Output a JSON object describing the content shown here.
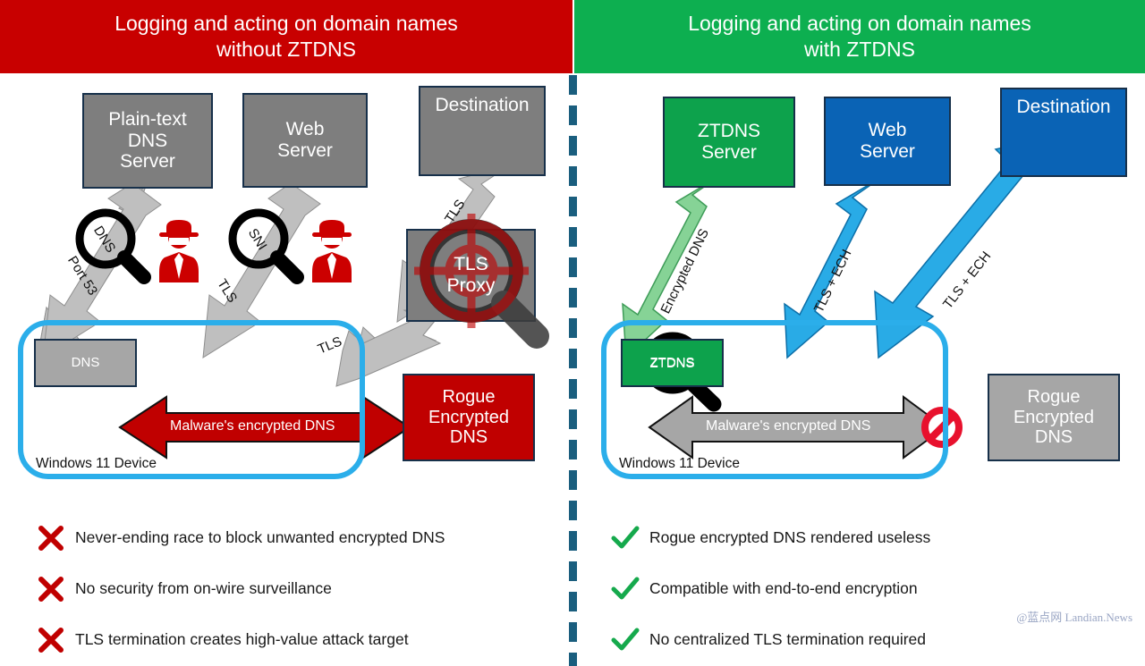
{
  "headers": {
    "left": "Logging and acting on domain names\nwithout ZTDNS",
    "left_line1": "Logging and acting on domain names",
    "left_line2": "without ZTDNS",
    "right_line1": "Logging and acting on domain names",
    "right_line2": "with ZTDNS"
  },
  "colors": {
    "header_red": "#C80000",
    "header_green": "#0DAF50",
    "divider": "#1A5E7E",
    "box_gray": "#7E7E7E",
    "box_gray_light": "#A6A6A6",
    "box_red": "#C00000",
    "box_green": "#0DA24C",
    "box_blue": "#0A63B5",
    "device_outline": "#2BAEEA",
    "arrow_gray": "#BFBFBF",
    "arrow_red": "#C00000",
    "arrow_blue": "#29ABE6",
    "arrow_green_light": "#86D396",
    "check_green": "#15A94C",
    "cross_red": "#C00000",
    "spy_red": "#CC0000",
    "watermark": "#9AA6C4"
  },
  "left_panel": {
    "nodes": [
      {
        "id": "plain-text-dns-server",
        "label": "Plain-text\nDNS\nServer",
        "line1": "Plain-text",
        "line2": "DNS",
        "line3": "Server",
        "color": "gray"
      },
      {
        "id": "web-server",
        "label": "Web\nServer",
        "line1": "Web",
        "line2": "Server",
        "color": "gray"
      },
      {
        "id": "destination",
        "label": "Destination",
        "color": "gray"
      },
      {
        "id": "tls-proxy",
        "label": "TLS\nProxy",
        "line1": "TLS",
        "line2": "Proxy",
        "color": "gray"
      },
      {
        "id": "dns-client",
        "label": "DNS",
        "color": "gray-light"
      },
      {
        "id": "rogue-encrypted-dns",
        "label": "Rogue\nEncrypted\nDNS",
        "line1": "Rogue",
        "line2": "Encrypted",
        "line3": "DNS",
        "color": "red"
      }
    ],
    "arrow_labels": {
      "port53": "Port 53",
      "tls_web": "TLS",
      "tls_proxy": "TLS",
      "tls_destination": "TLS",
      "malware": "Malware's encrypted DNS"
    },
    "magnifier_labels": {
      "dns": "DNS",
      "sni": "SNI"
    },
    "device_label": "Windows 11 Device",
    "spy_icons": 2
  },
  "right_panel": {
    "nodes": [
      {
        "id": "ztdns-server",
        "label": "ZTDNS\nServer",
        "line1": "ZTDNS",
        "line2": "Server",
        "color": "green"
      },
      {
        "id": "web-server",
        "label": "Web\nServer",
        "line1": "Web",
        "line2": "Server",
        "color": "blue"
      },
      {
        "id": "destination",
        "label": "Destination",
        "color": "blue"
      },
      {
        "id": "ztdns-client",
        "label": "ZTDNS",
        "color": "green"
      },
      {
        "id": "rogue-encrypted-dns",
        "label": "Rogue\nEncrypted\nDNS",
        "line1": "Rogue",
        "line2": "Encrypted",
        "line3": "DNS",
        "color": "gray-light"
      }
    ],
    "arrow_labels": {
      "encrypted_dns": "Encrypted DNS",
      "tls_ech_web": "TLS + ECH",
      "tls_ech_destination": "TLS + ECH",
      "malware": "Malware's encrypted DNS"
    },
    "device_label": "Windows 11 Device",
    "blocked_icon": "no-entry-icon"
  },
  "left_bullets": [
    {
      "marker": "cross-icon",
      "text": "Never-ending race to block unwanted encrypted DNS"
    },
    {
      "marker": "cross-icon",
      "text": "No security from on-wire surveillance"
    },
    {
      "marker": "cross-icon",
      "text": "TLS termination creates high-value attack target"
    }
  ],
  "right_bullets": [
    {
      "marker": "check-icon",
      "text": "Rogue encrypted DNS rendered useless"
    },
    {
      "marker": "check-icon",
      "text": "Compatible with end-to-end encryption"
    },
    {
      "marker": "check-icon",
      "text": "No centralized TLS termination required"
    }
  ],
  "watermark": "@蓝点网 Landian.News"
}
